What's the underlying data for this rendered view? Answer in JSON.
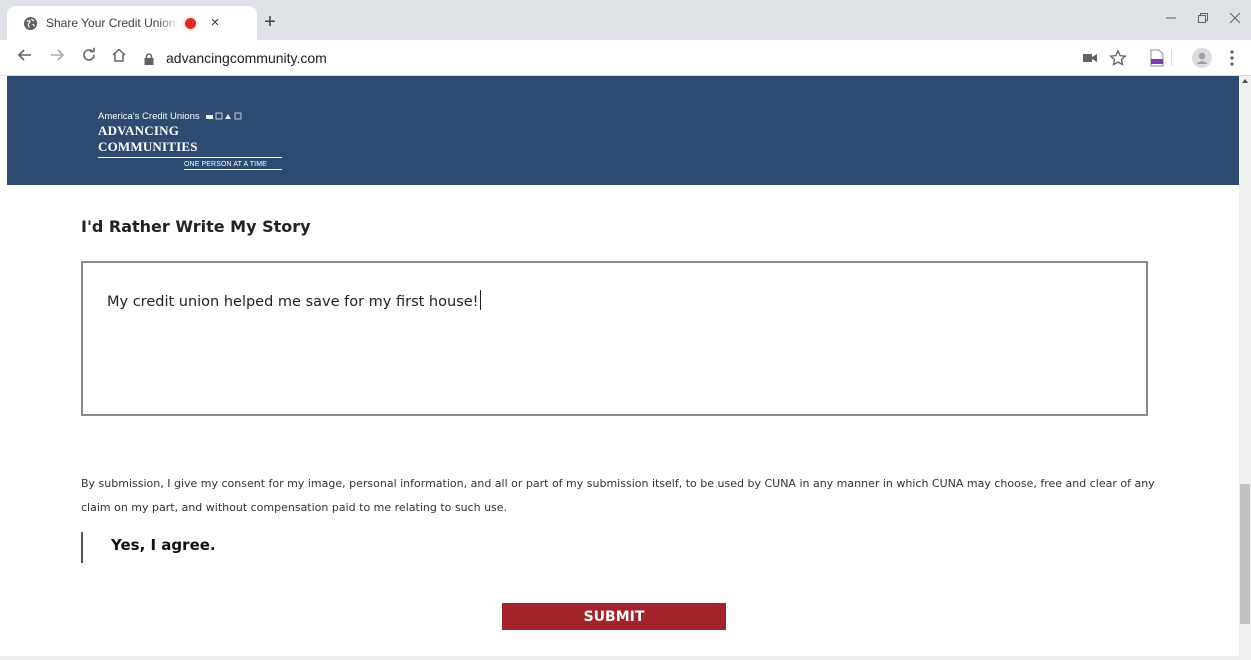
{
  "browser": {
    "tab_title": "Share Your Credit Union Story",
    "new_tab_symbol": "+",
    "close_symbol": "×",
    "url": "advancingcommunity.com",
    "icons": {
      "favicon": "globe-icon",
      "back": "back-arrow-icon",
      "forward": "forward-arrow-icon",
      "reload": "reload-icon",
      "home": "home-icon",
      "lock": "lock-icon",
      "camera": "camera-icon",
      "bookmark": "star-icon",
      "extension": "pdf-extension-icon",
      "profile": "profile-avatar-icon",
      "menu": "kebab-menu-icon"
    },
    "record_color": "#d93025"
  },
  "banner": {
    "color": "#2d4a70",
    "logo": {
      "line1": "America's Credit Unions",
      "line2": "ADVANCING COMMUNITIES",
      "line3": "ONE PERSON AT A TIME"
    }
  },
  "form": {
    "section_title": "I'd Rather Write My Story",
    "story_text": "My credit union helped me save for my first house!",
    "consent_text": "By submission, I give my consent for my image, personal information, and all or part of my submission itself, to be used by CUNA in any manner in which CUNA may choose, free and clear of any claim on my part, and without compensation paid to me relating to such use.",
    "agree_label": "Yes, I agree.",
    "submit_label": "SUBMIT",
    "submit_color": "#a3232a"
  }
}
